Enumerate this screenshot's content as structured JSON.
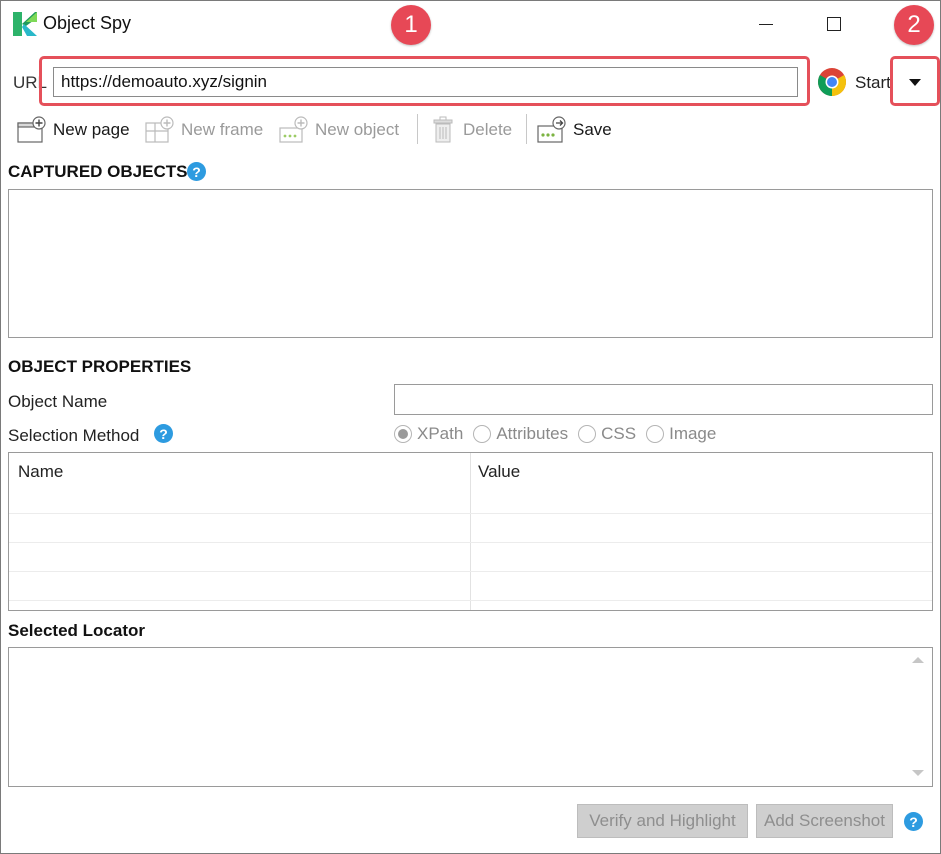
{
  "window": {
    "title": "Object Spy"
  },
  "annotations": {
    "badge1": "1",
    "badge2": "2"
  },
  "url_bar": {
    "label": "URL",
    "value": "https://demoauto.xyz/signin",
    "start_label": "Start",
    "browser_icon": "chrome-icon"
  },
  "toolbar": {
    "new_page": "New page",
    "new_frame": "New frame",
    "new_object": "New object",
    "delete": "Delete",
    "save": "Save"
  },
  "captured_objects": {
    "heading": "CAPTURED OBJECTS"
  },
  "object_properties": {
    "heading": "OBJECT PROPERTIES",
    "object_name_label": "Object Name",
    "object_name_value": "",
    "selection_method_label": "Selection Method",
    "selection_methods": [
      "XPath",
      "Attributes",
      "CSS",
      "Image"
    ],
    "selected_method": "XPath",
    "table": {
      "columns": [
        "Name",
        "Value"
      ]
    }
  },
  "selected_locator": {
    "heading": "Selected Locator",
    "value": ""
  },
  "footer": {
    "verify_button": "Verify and Highlight",
    "screenshot_button": "Add Screenshot"
  },
  "colors": {
    "highlight": "#e5505a",
    "badge": "#e74856",
    "help": "#2d9be0"
  }
}
